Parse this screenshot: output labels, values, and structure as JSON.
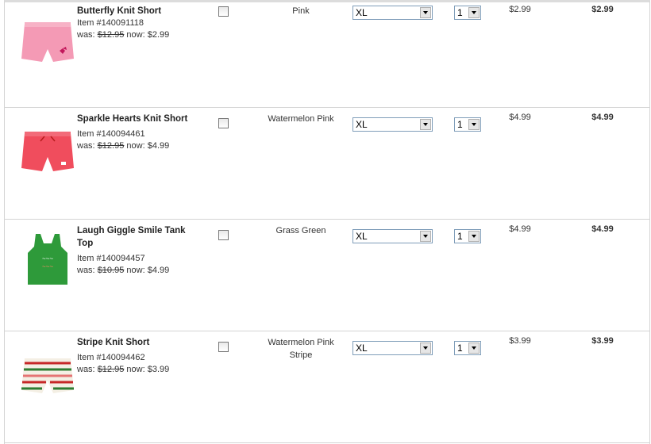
{
  "rows": [
    {
      "name": "Butterfly Knit Short",
      "item": "Item #140091118",
      "was_label": "was:",
      "was": "$12.95",
      "now_label": "now:",
      "now": "$2.99",
      "color": "Pink",
      "size": "XL",
      "qty": "1",
      "unit": "$2.99",
      "total": "$2.99",
      "image": "pink-short"
    },
    {
      "name": "Sparkle Hearts Knit Short",
      "item": "Item #140094461",
      "was_label": "was:",
      "was": "$12.95",
      "now_label": "now:",
      "now": "$4.99",
      "color": "Watermelon Pink",
      "size": "XL",
      "qty": "1",
      "unit": "$4.99",
      "total": "$4.99",
      "image": "coral-short"
    },
    {
      "name": "Laugh Giggle Smile Tank Top",
      "item": "Item #140094457",
      "was_label": "was:",
      "was": "$10.95",
      "now_label": "now:",
      "now": "$4.99",
      "color": "Grass Green",
      "size": "XL",
      "qty": "1",
      "unit": "$4.99",
      "total": "$4.99",
      "image": "green-tank"
    },
    {
      "name": "Stripe Knit Short",
      "item": "Item #140094462",
      "was_label": "was:",
      "was": "$12.95",
      "now_label": "now:",
      "now": "$3.99",
      "color": "Watermelon Pink Stripe",
      "size": "XL",
      "qty": "1",
      "unit": "$3.99",
      "total": "$3.99",
      "image": "stripe-short"
    }
  ]
}
